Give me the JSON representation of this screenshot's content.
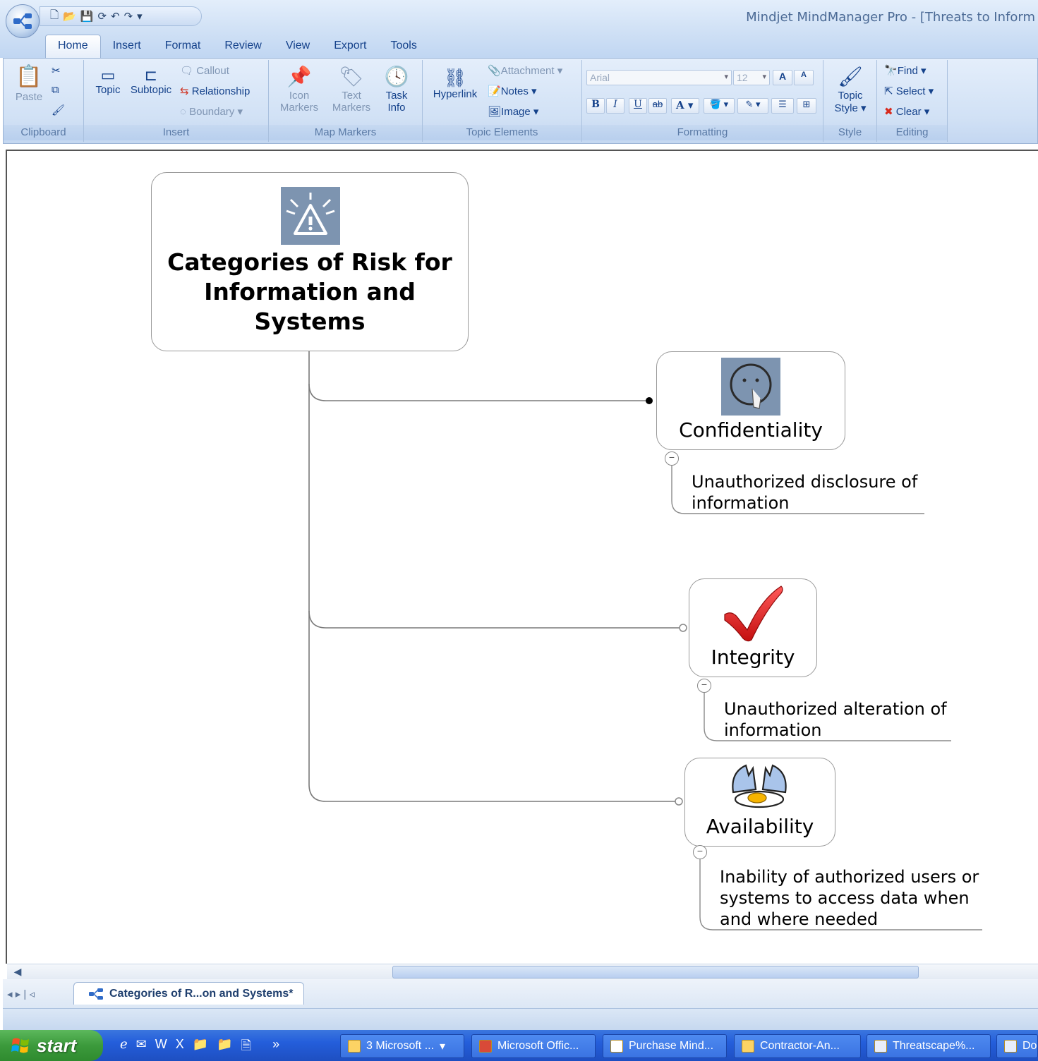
{
  "window": {
    "title": "Mindjet MindManager Pro - [Threats to Inform",
    "qat_icons": [
      "new-icon",
      "open-icon",
      "save-icon",
      "undo-icon",
      "redo-icon"
    ]
  },
  "ribbon": {
    "tabs": [
      "Home",
      "Insert",
      "Format",
      "Review",
      "View",
      "Export",
      "Tools"
    ],
    "active_tab": "Home",
    "groups": {
      "clipboard": {
        "label": "Clipboard",
        "paste": "Paste"
      },
      "insert": {
        "label": "Insert",
        "topic": "Topic",
        "subtopic": "Subtopic",
        "callout": "Callout",
        "relationship": "Relationship",
        "boundary": "Boundary"
      },
      "map_markers": {
        "label": "Map Markers",
        "icon_markers_1": "Icon",
        "icon_markers_2": "Markers",
        "text_markers_1": "Text",
        "text_markers_2": "Markers",
        "task_info_1": "Task",
        "task_info_2": "Info"
      },
      "topic_elements": {
        "label": "Topic Elements",
        "hyperlink": "Hyperlink",
        "attachment": "Attachment",
        "notes": "Notes",
        "image": "Image"
      },
      "formatting": {
        "label": "Formatting",
        "font": "Arial",
        "size": "12",
        "bold": "B",
        "italic": "I",
        "underline": "U",
        "font_color": "A"
      },
      "style": {
        "label": "Style",
        "topic_style_1": "Topic",
        "topic_style_2": "Style"
      },
      "editing": {
        "label": "Editing",
        "find": "Find",
        "select": "Select",
        "clear": "Clear"
      }
    }
  },
  "map": {
    "central": {
      "title": "Categories of Risk for Information and Systems",
      "icon": "warning-icon"
    },
    "subtopics": [
      {
        "label": "Confidentiality",
        "icon": "hush-face-icon",
        "note": "Unauthorized disclosure of information"
      },
      {
        "label": "Integrity",
        "icon": "checkmark-icon",
        "note": "Unauthorized alteration of information"
      },
      {
        "label": "Availability",
        "icon": "broken-egg-icon",
        "note": "Inability of authorized users or systems to access data when and where needed"
      }
    ]
  },
  "document_tab": {
    "label": "Categories of R...on and Systems*"
  },
  "taskbar": {
    "start": "start",
    "tasks": [
      "3 Microsoft ...",
      "Microsoft Offic...",
      "Purchase Mind...",
      "Contractor-An...",
      "Threatscape%...",
      "Do"
    ]
  },
  "colors": {
    "ribbon_text": "#15428b",
    "taskbar": "#245edb",
    "start_green": "#3c9a3c",
    "checkmark_red": "#e31b1b"
  }
}
